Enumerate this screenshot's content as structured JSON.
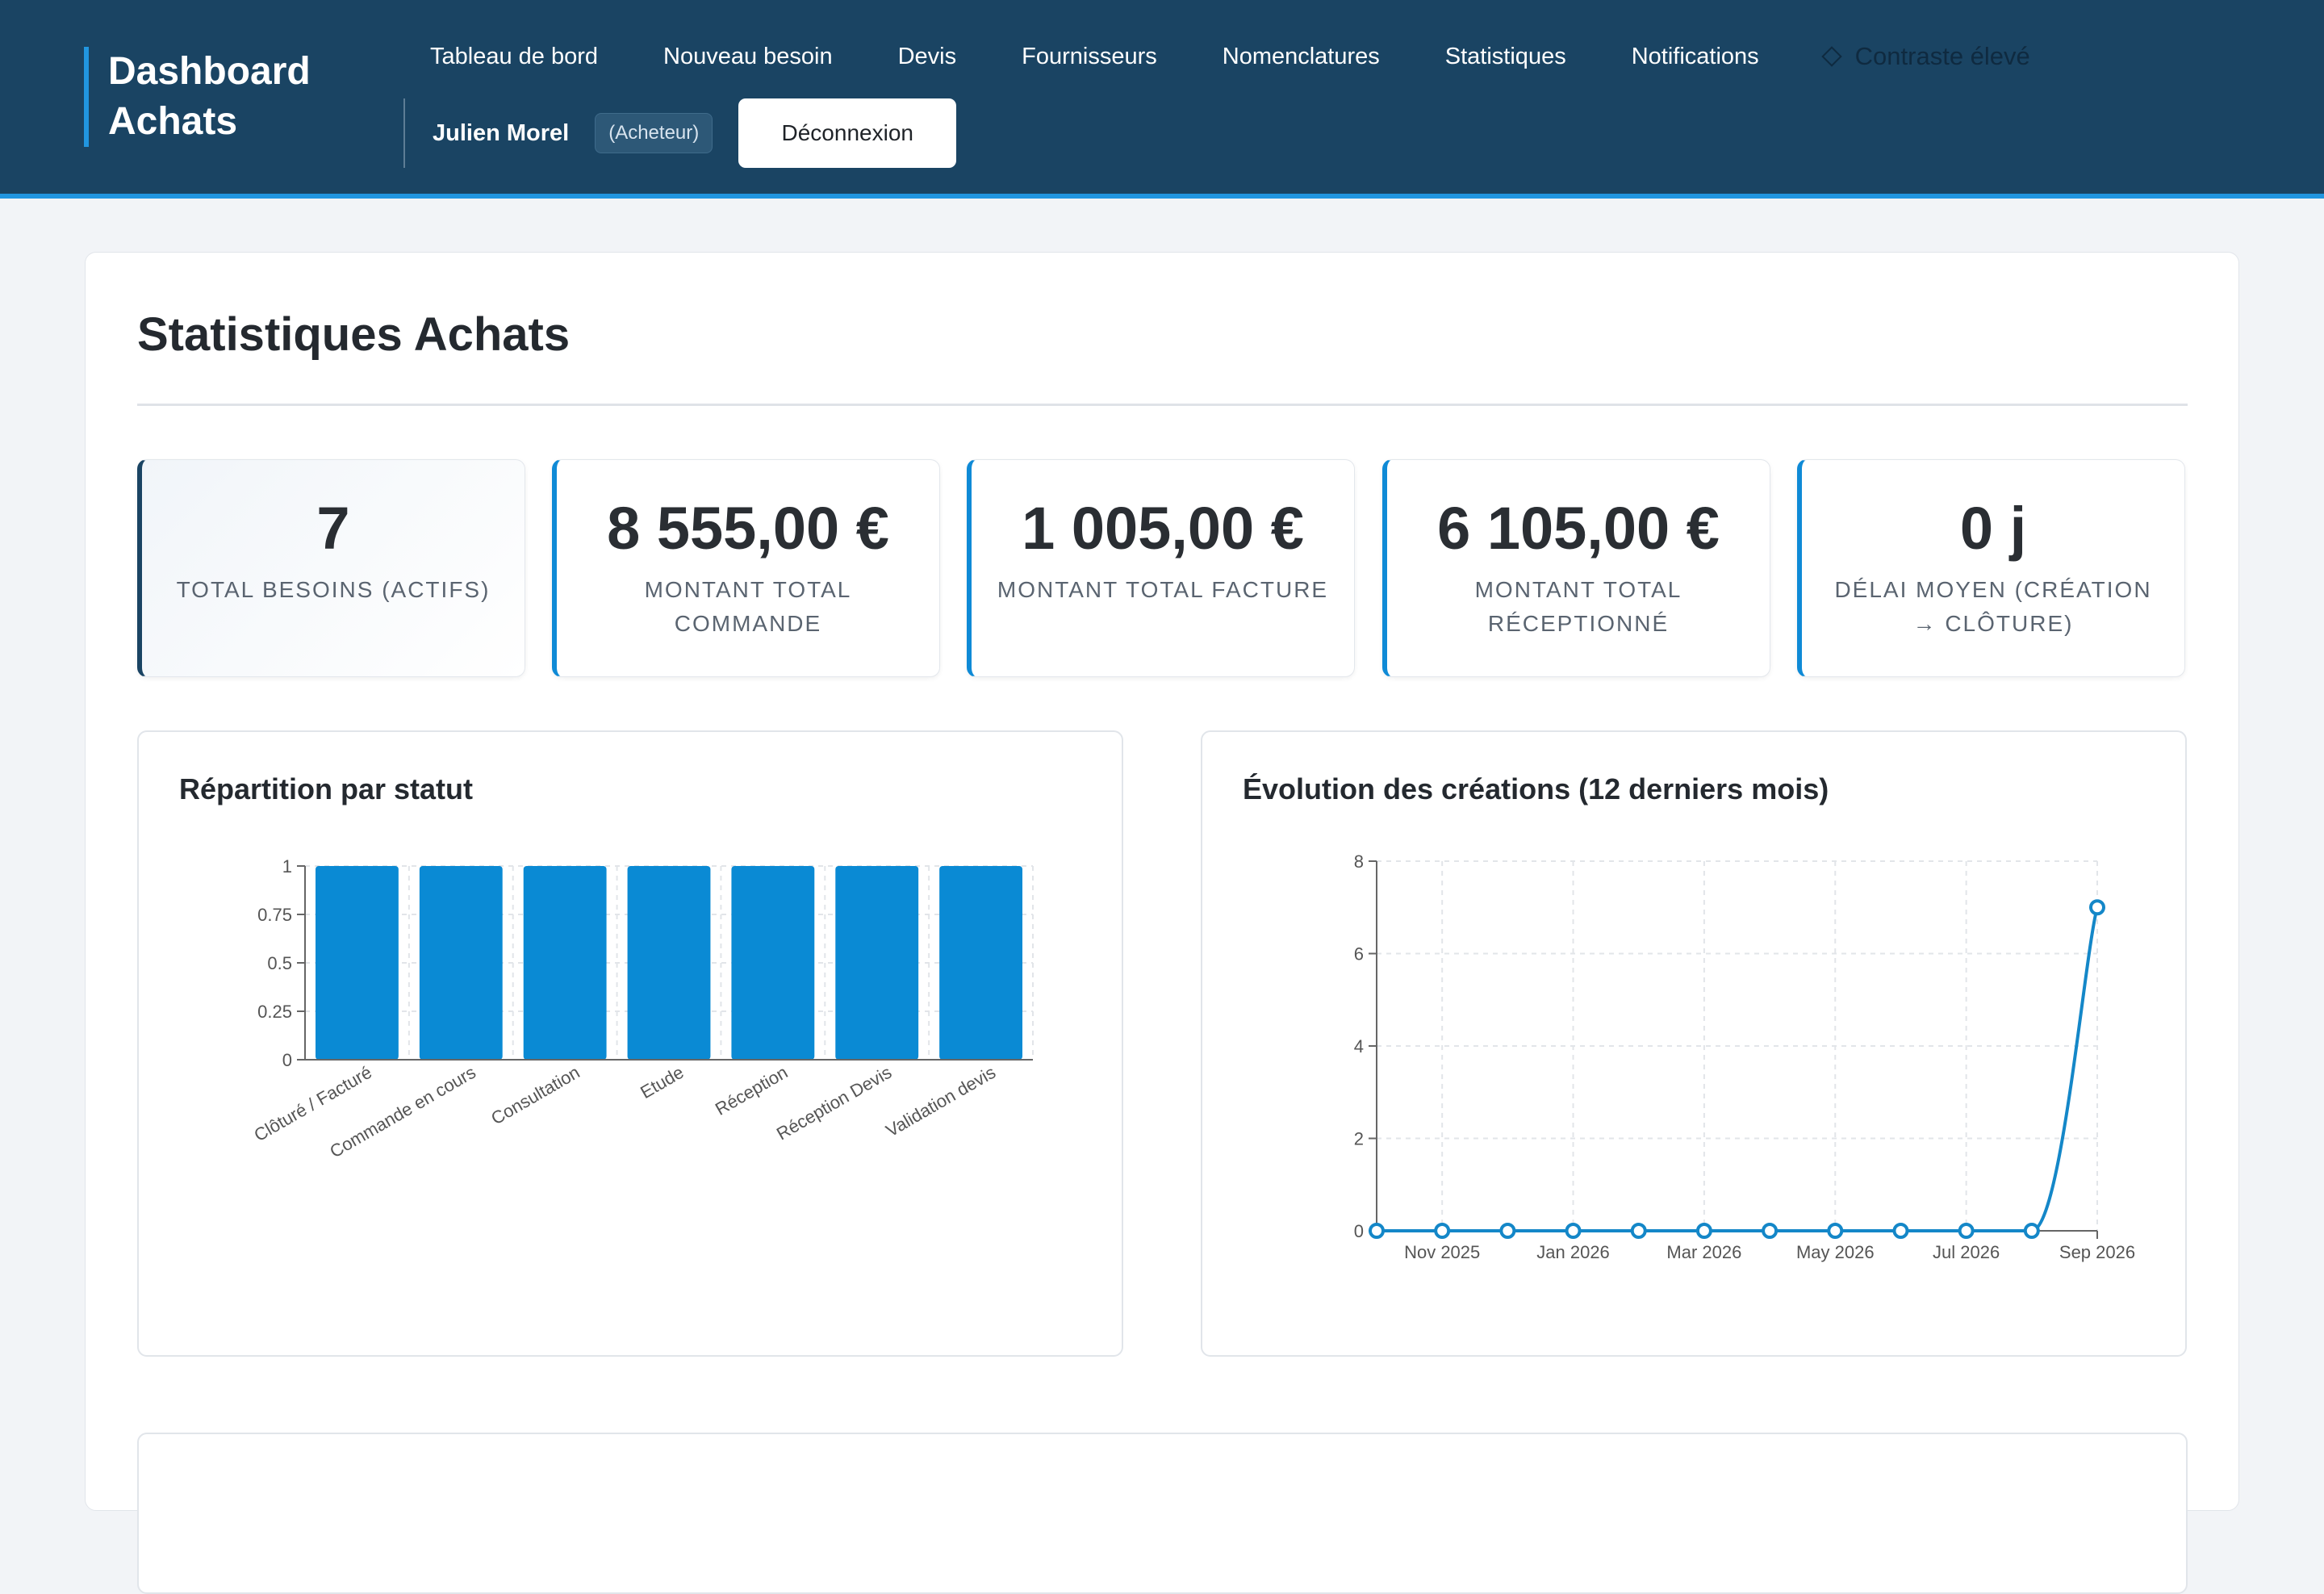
{
  "header": {
    "brand_line1": "Dashboard",
    "brand_line2": "Achats",
    "nav": [
      {
        "label": "Tableau de bord"
      },
      {
        "label": "Nouveau besoin"
      },
      {
        "label": "Devis"
      },
      {
        "label": "Fournisseurs"
      },
      {
        "label": "Nomenclatures"
      },
      {
        "label": "Statistiques"
      },
      {
        "label": "Notifications"
      }
    ],
    "contrast_label": "Contraste élevé",
    "user_name": "Julien Morel",
    "user_role": "(Acheteur)",
    "logout_label": "Déconnexion"
  },
  "page": {
    "title": "Statistiques Achats"
  },
  "kpis": [
    {
      "value": "7",
      "label": "Total besoins (actifs)"
    },
    {
      "value": "8 555,00 €",
      "label": "Montant total commande"
    },
    {
      "value": "1 005,00 €",
      "label": "Montant total facture"
    },
    {
      "value": "6 105,00 €",
      "label": "Montant total réceptionné"
    },
    {
      "value": "0 j",
      "label": "Délai moyen (création → clôture)"
    }
  ],
  "colors": {
    "header_bg": "#1a4463",
    "accent": "#2196e0",
    "bar": "#0a8ad4",
    "line": "#1487c8"
  },
  "chart_data": [
    {
      "type": "bar",
      "title": "Répartition par statut",
      "categories": [
        "Clôturé / Facturé",
        "Commande en cours",
        "Consultation",
        "Etude",
        "Réception",
        "Réception Devis",
        "Validation devis"
      ],
      "values": [
        1,
        1,
        1,
        1,
        1,
        1,
        1
      ],
      "ylim": [
        0,
        1
      ],
      "yticks": [
        "0",
        "0.25",
        "0.5",
        "0.75",
        "1"
      ],
      "grid": true
    },
    {
      "type": "line",
      "title": "Évolution des créations (12 derniers mois)",
      "x": [
        "Oct 2025",
        "Nov 2025",
        "Dec 2025",
        "Jan 2026",
        "Feb 2026",
        "Mar 2026",
        "Apr 2026",
        "May 2026",
        "Jun 2026",
        "Jul 2026",
        "Aug 2026",
        "Sep 2026"
      ],
      "xtick_labels": [
        "Nov 2025",
        "Jan 2026",
        "Mar 2026",
        "May 2026",
        "Jul 2026",
        "Sep 2026"
      ],
      "values": [
        0,
        0,
        0,
        0,
        0,
        0,
        0,
        0,
        0,
        0,
        0,
        7
      ],
      "ylim": [
        0,
        8
      ],
      "yticks": [
        "0",
        "2",
        "4",
        "6",
        "8"
      ],
      "grid": true
    }
  ]
}
